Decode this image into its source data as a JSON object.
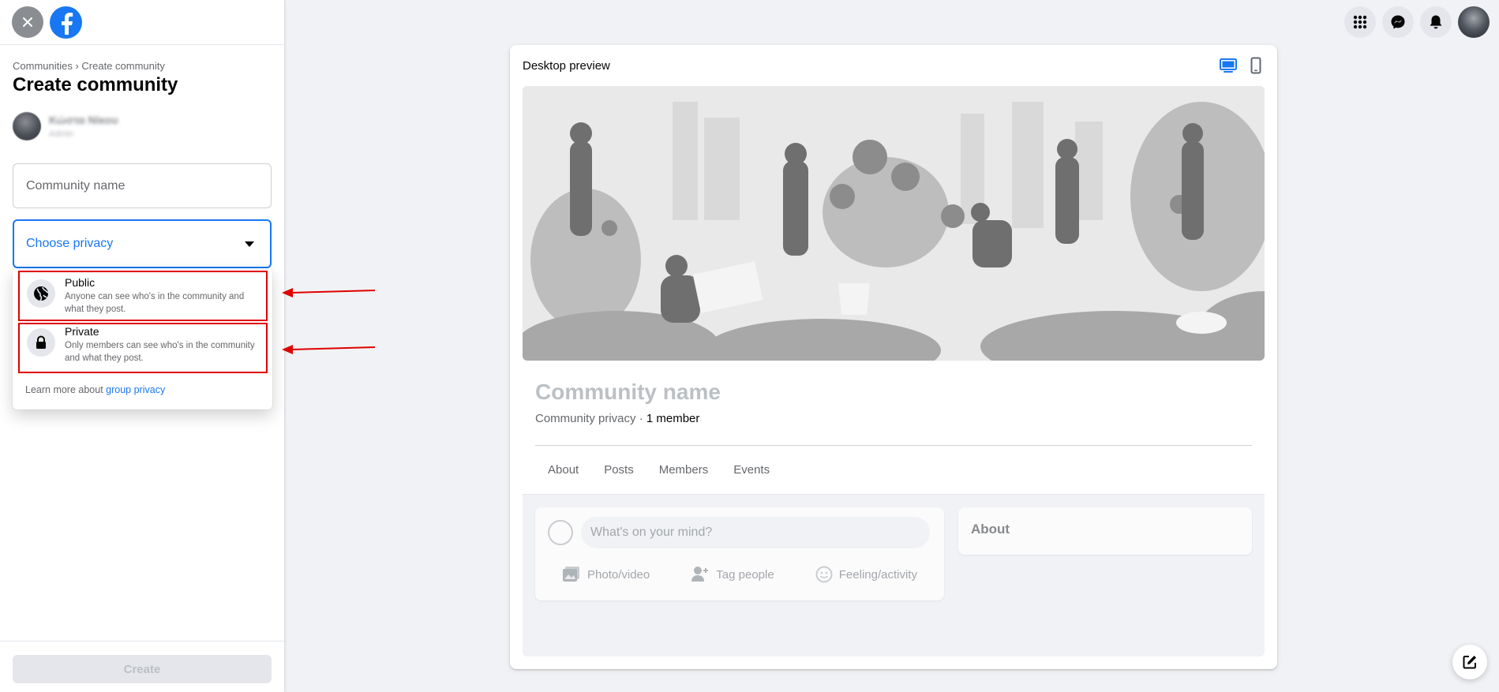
{
  "sidebar": {
    "breadcrumb": "Communities › Create community",
    "title": "Create community",
    "owner": {
      "name": "Κώστα Νίκου",
      "role": "Admin"
    },
    "community_name_placeholder": "Community name",
    "privacy_placeholder": "Choose privacy",
    "privacy_options": [
      {
        "title": "Public",
        "description": "Anyone can see who's in the community and what they post."
      },
      {
        "title": "Private",
        "description": "Only members can see who's in the community and what they post."
      }
    ],
    "learn_more_prefix": "Learn more about ",
    "learn_more_link": "group privacy",
    "create_label": "Create"
  },
  "preview": {
    "title": "Desktop preview",
    "community_name": "Community name",
    "meta_prefix": "Community privacy · ",
    "meta_members": "1 member",
    "tabs": [
      "About",
      "Posts",
      "Members",
      "Events"
    ],
    "composer_placeholder": "What's on your mind?",
    "composer_actions": [
      "Photo/video",
      "Tag people",
      "Feeling/activity"
    ],
    "about_title": "About"
  },
  "colors": {
    "accent": "#1877f2",
    "highlight": "#e00000",
    "background": "#f0f2f5"
  },
  "icons": {
    "close": "close-icon",
    "logo": "facebook-logo",
    "menu": "grid-menu-icon",
    "messenger": "messenger-icon",
    "notifications": "bell-icon",
    "compose": "new-message-icon"
  }
}
